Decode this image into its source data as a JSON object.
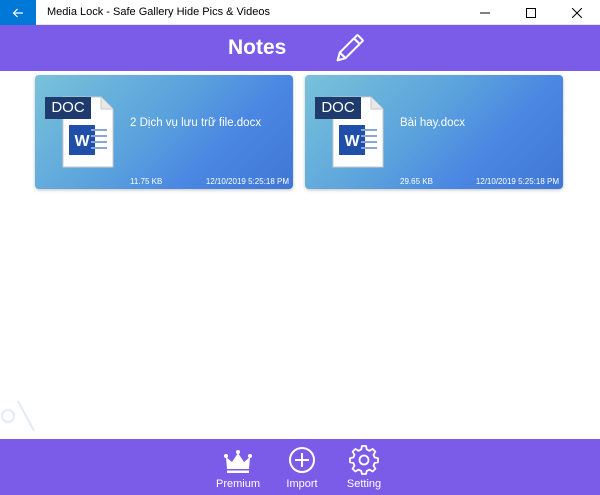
{
  "window": {
    "title": "Media Lock - Safe Gallery Hide Pics & Videos"
  },
  "header": {
    "title": "Notes"
  },
  "files": [
    {
      "name": "2 Dịch vụ lưu trữ file.docx",
      "size": "11.75  KB",
      "date": "12/10/2019 5:25:18 PM",
      "badge": "DOC"
    },
    {
      "name": "Bài hay.docx",
      "size": "29.65  KB",
      "date": "12/10/2019 5:25:18 PM",
      "badge": "DOC"
    }
  ],
  "nav": {
    "premium": "Premium",
    "import": "Import",
    "setting": "Setting"
  },
  "colors": {
    "accent": "#7b5ce8",
    "titlebar_back": "#0078d7",
    "card_gradient_start": "#79c2d9",
    "card_gradient_end": "#3f78d4",
    "word_blue": "#1f4fa8"
  },
  "icons": {
    "back": "arrow-left-icon",
    "minimize": "minimize-icon",
    "maximize": "maximize-icon",
    "close": "close-icon",
    "edit": "pencil-icon",
    "file": "word-doc-icon",
    "premium": "crown-icon",
    "import": "plus-circle-icon",
    "setting": "gear-icon"
  }
}
